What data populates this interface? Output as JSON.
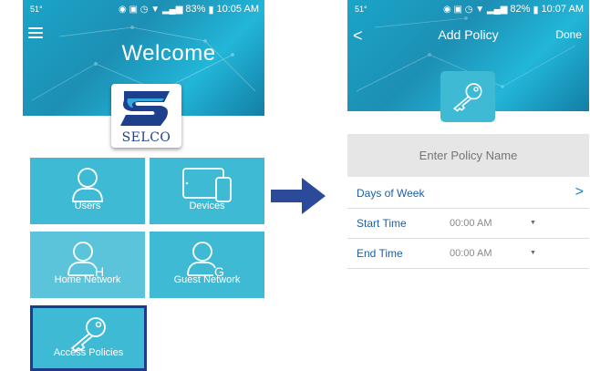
{
  "left_phone": {
    "status": {
      "temp": "51°",
      "battery": "83%",
      "time": "10:05 AM"
    },
    "header_title": "Welcome",
    "logo_text": "SELCO",
    "tiles": [
      {
        "label": "Users"
      },
      {
        "label": "Devices"
      },
      {
        "label": "Home Network"
      },
      {
        "label": "Guest Network"
      },
      {
        "label": "Access Policies"
      }
    ]
  },
  "right_phone": {
    "status": {
      "temp": "51°",
      "battery": "82%",
      "time": "10:07 AM"
    },
    "back_label": "<",
    "title": "Add Policy",
    "done_label": "Done",
    "policy_name": {
      "placeholder": "Enter Policy Name",
      "value": ""
    },
    "rows": [
      {
        "label": "Days of Week",
        "chevron": ">"
      },
      {
        "label": "Start Time",
        "value": "00:00 AM",
        "caret": "▼"
      },
      {
        "label": "End Time",
        "value": "00:00 AM",
        "caret": "▼"
      }
    ]
  },
  "colors": {
    "tile": "#3fbad5",
    "tile_light": "#5bc4db",
    "selected_border": "#1d3b8c",
    "arrow": "#2b4a9a",
    "link_blue": "#1d5fa6"
  },
  "icons": {
    "menu": "hamburger-icon",
    "users": "user-icon",
    "devices": "tablet-phone-icon",
    "home_network": "user-h-icon",
    "guest_network": "user-g-icon",
    "access_policies": "key-icon",
    "arrow": "right-arrow-icon"
  }
}
